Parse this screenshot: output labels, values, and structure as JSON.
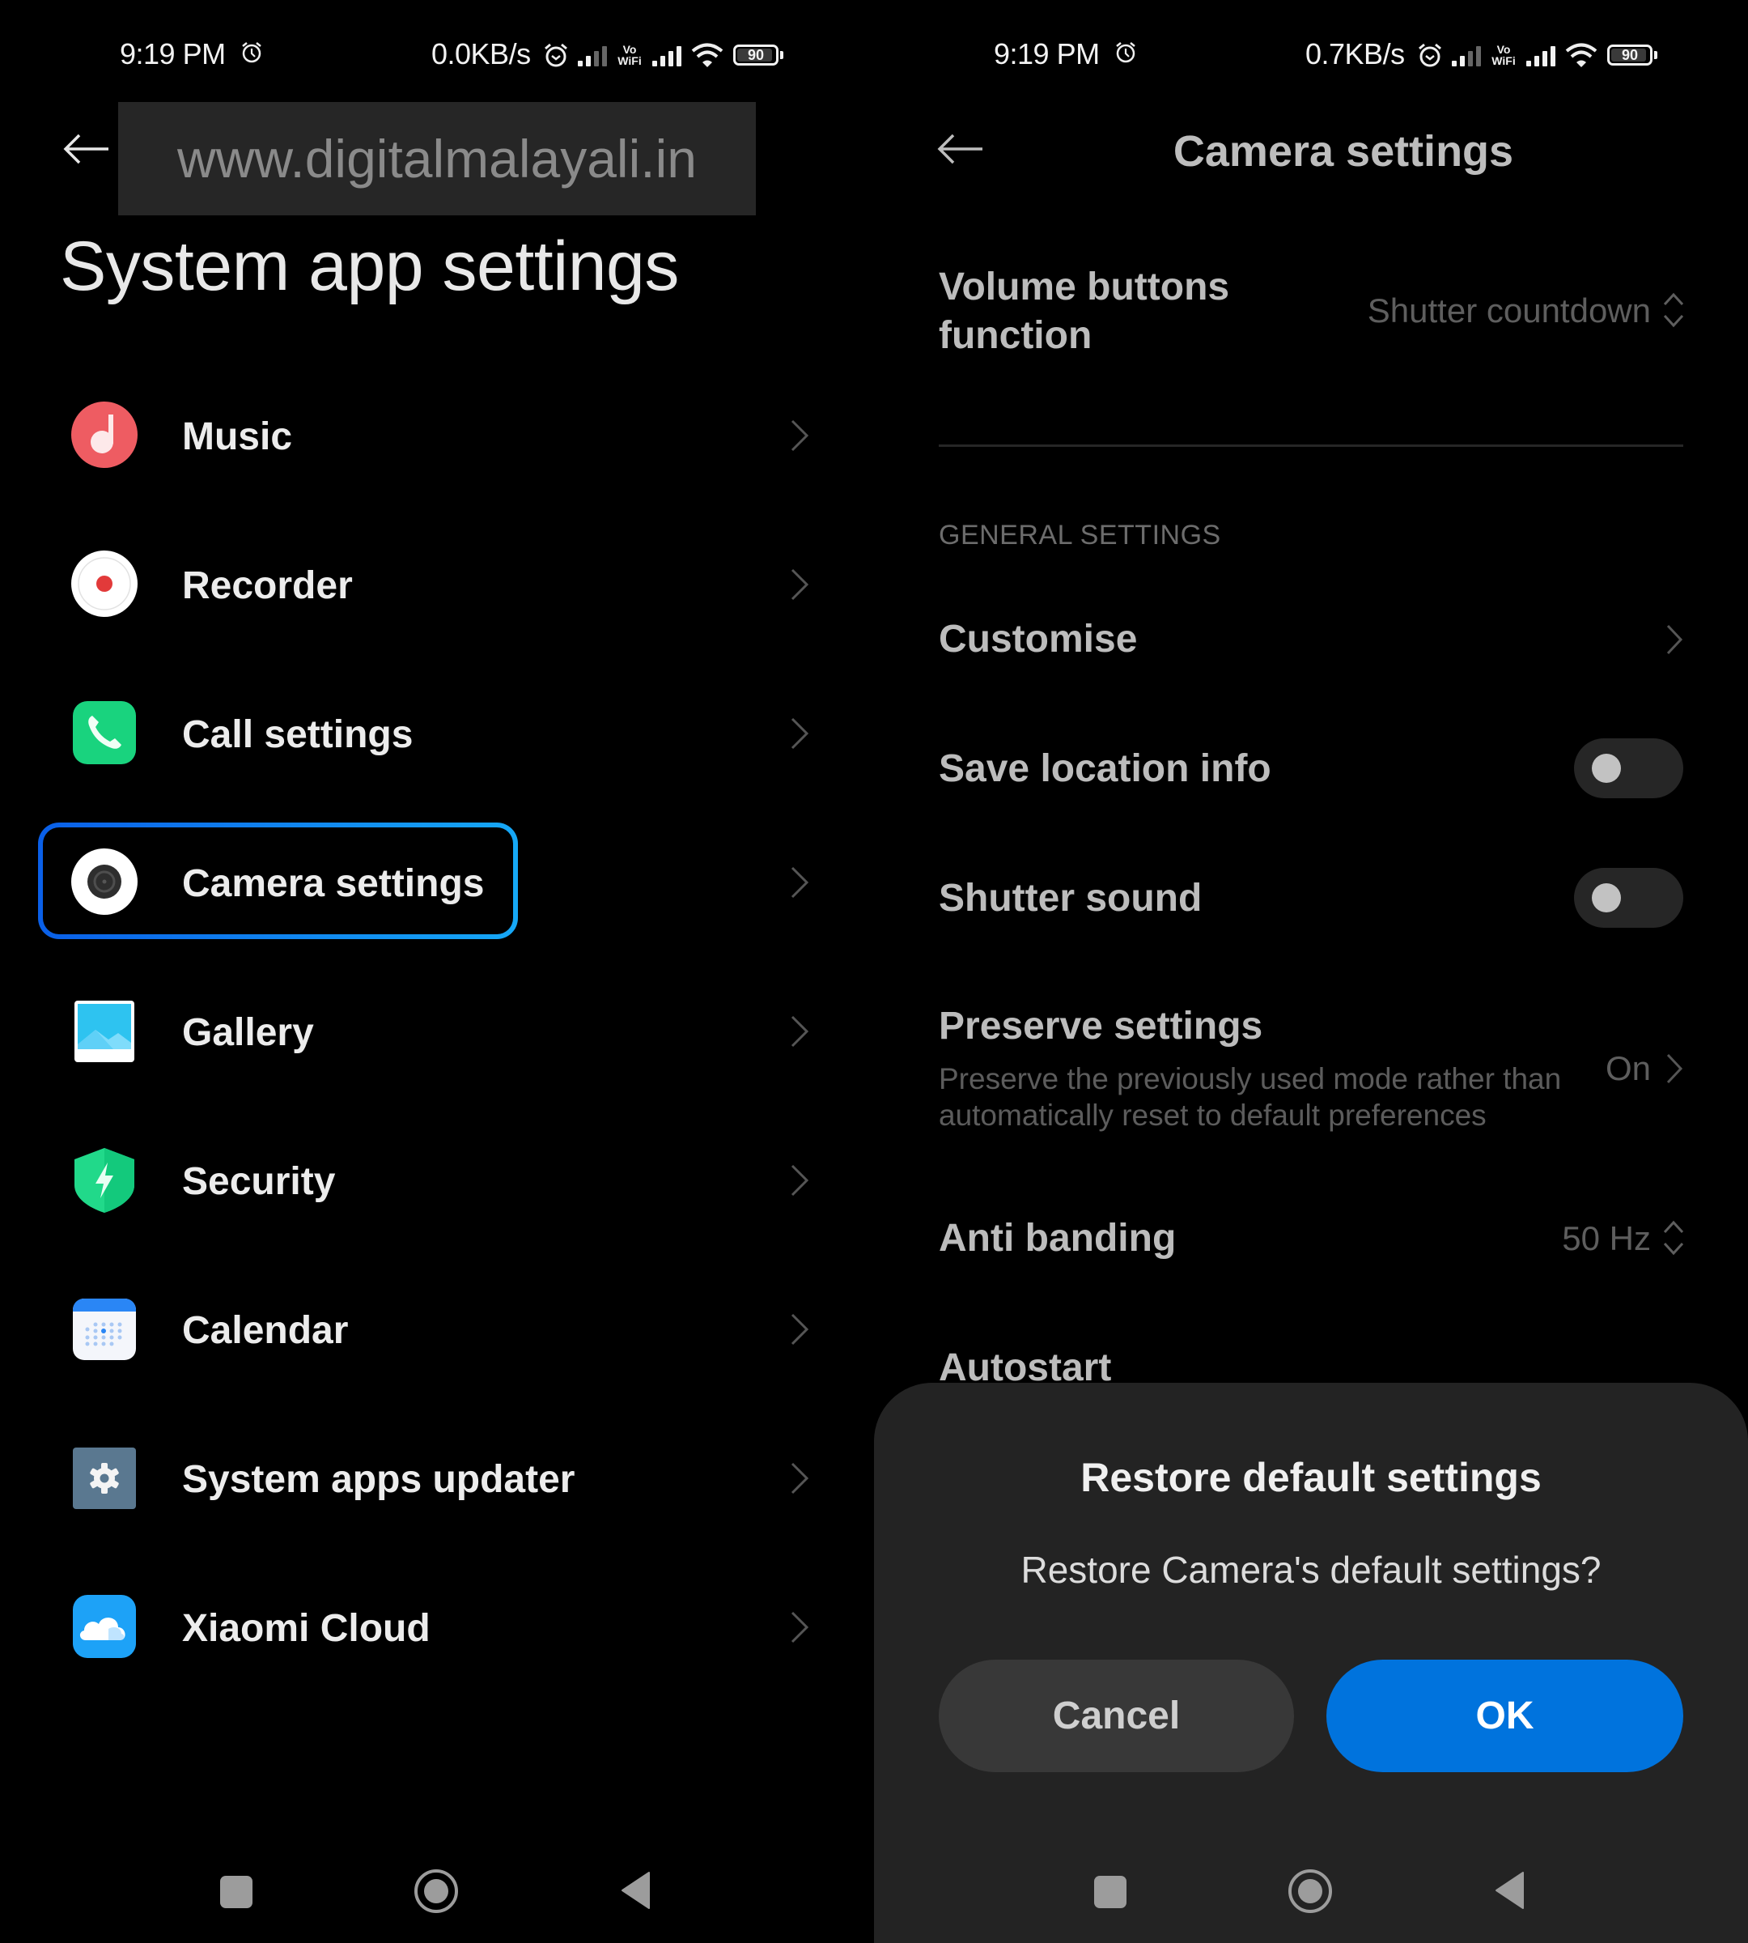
{
  "left_screen": {
    "status_bar": {
      "time": "9:19 PM",
      "network_speed": "0.0KB/s",
      "vowifi_top": "Vo",
      "vowifi_bottom": "WiFi",
      "battery": "90"
    },
    "watermark": "www.digitalmalayali.in",
    "page_title": "System app settings",
    "items": [
      {
        "label": "Music",
        "icon": "music-icon"
      },
      {
        "label": "Recorder",
        "icon": "recorder-icon"
      },
      {
        "label": "Call settings",
        "icon": "phone-icon"
      },
      {
        "label": "Camera settings",
        "icon": "camera-icon",
        "highlighted": true
      },
      {
        "label": "Gallery",
        "icon": "gallery-icon"
      },
      {
        "label": "Security",
        "icon": "shield-icon"
      },
      {
        "label": "Calendar",
        "icon": "calendar-icon"
      },
      {
        "label": "System apps updater",
        "icon": "gear-icon"
      },
      {
        "label": "Xiaomi Cloud",
        "icon": "cloud-icon"
      }
    ],
    "highlight_color": "#0a5fe8"
  },
  "right_screen": {
    "status_bar": {
      "time": "9:19 PM",
      "network_speed": "0.7KB/s",
      "vowifi_top": "Vo",
      "vowifi_bottom": "WiFi",
      "battery": "90"
    },
    "title": "Camera settings",
    "volume_buttons": {
      "title_line1": "Volume buttons",
      "title_line2": "function",
      "value": "Shutter countdown"
    },
    "section_header": "GENERAL SETTINGS",
    "customise": "Customise",
    "save_location": {
      "label": "Save location info",
      "on": false
    },
    "shutter_sound": {
      "label": "Shutter sound",
      "on": false
    },
    "preserve": {
      "title": "Preserve settings",
      "desc_line1": "Preserve the previously used mode rather than",
      "desc_line2": "automatically reset to default preferences",
      "value": "On"
    },
    "anti_banding": {
      "label": "Anti banding",
      "value": "50 Hz"
    },
    "autostart": "Autostart",
    "dialog": {
      "title": "Restore default settings",
      "message": "Restore Camera's default settings?",
      "cancel": "Cancel",
      "ok": "OK",
      "ok_color": "#0073dd"
    }
  }
}
